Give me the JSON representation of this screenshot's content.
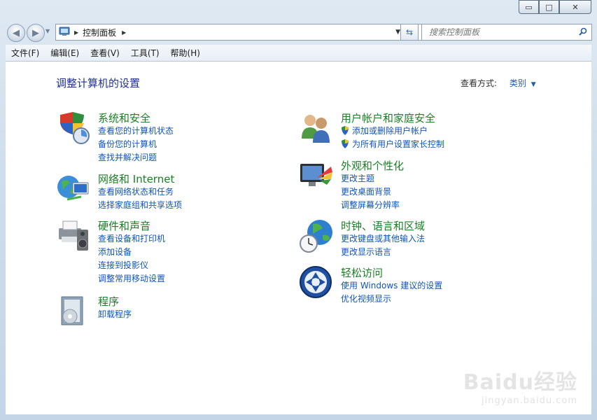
{
  "window": {
    "minimize": "▭",
    "maximize": "□",
    "close": "✕"
  },
  "address": {
    "path": "控制面板",
    "search_placeholder": "搜索控制面板"
  },
  "menu": [
    "文件(F)",
    "编辑(E)",
    "查看(V)",
    "工具(T)",
    "帮助(H)"
  ],
  "main": {
    "title": "调整计算机的设置",
    "view_by_label": "查看方式:",
    "view_by_value": "类别"
  },
  "categories": [
    {
      "title": "系统和安全",
      "icon": "system-security-icon",
      "links": [
        "查看您的计算机状态",
        "备份您的计算机",
        "查找并解决问题"
      ]
    },
    {
      "title": "网络和 Internet",
      "icon": "network-internet-icon",
      "links": [
        "查看网络状态和任务",
        "选择家庭组和共享选项"
      ]
    },
    {
      "title": "硬件和声音",
      "icon": "hardware-sound-icon",
      "links": [
        "查看设备和打印机",
        "添加设备",
        "连接到投影仪",
        "调整常用移动设置"
      ]
    },
    {
      "title": "程序",
      "icon": "programs-icon",
      "links": [
        "卸载程序"
      ]
    },
    {
      "title": "用户帐户和家庭安全",
      "icon": "user-accounts-icon",
      "links": [
        "添加或删除用户帐户",
        "为所有用户设置家长控制"
      ]
    },
    {
      "title": "外观和个性化",
      "icon": "appearance-icon",
      "links": [
        "更改主题",
        "更改桌面背景",
        "调整屏幕分辨率"
      ]
    },
    {
      "title": "时钟、语言和区域",
      "icon": "clock-region-icon",
      "links": [
        "更改键盘或其他输入法",
        "更改显示语言"
      ]
    },
    {
      "title": "轻松访问",
      "icon": "ease-of-access-icon",
      "links": [
        "使用 Windows 建议的设置",
        "优化视频显示"
      ]
    }
  ],
  "watermark": {
    "title": "Baidu经验",
    "sub": "jingyan.baidu.com"
  }
}
